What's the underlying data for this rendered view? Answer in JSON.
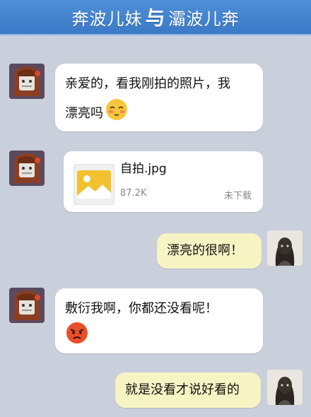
{
  "header": {
    "title_left": "奔波儿妹",
    "title_sep": "与",
    "title_right": "灞波儿奔"
  },
  "messages": [
    {
      "side": "left",
      "line1": "亲爱的，看我刚拍的照片，我",
      "line2": "漂亮吗",
      "emoji": "blushing-face-icon"
    },
    {
      "side": "left",
      "type": "file",
      "file_name": "自拍.jpg",
      "file_size": "87.2K",
      "file_status": "未下载",
      "icon": "image-file-icon"
    },
    {
      "side": "right",
      "text": "漂亮的很啊！"
    },
    {
      "side": "left",
      "line1": "敷衍我啊，你都还没看呢！",
      "emoji": "angry-face-icon"
    },
    {
      "side": "right",
      "text": "就是没看才说好看的"
    }
  ],
  "colors": {
    "background": "#c9cfdb",
    "header": "#3a7ac6",
    "left_bubble": "#ffffff",
    "right_bubble": "#f7f4c4",
    "file_icon_accent": "#f2c12e"
  }
}
